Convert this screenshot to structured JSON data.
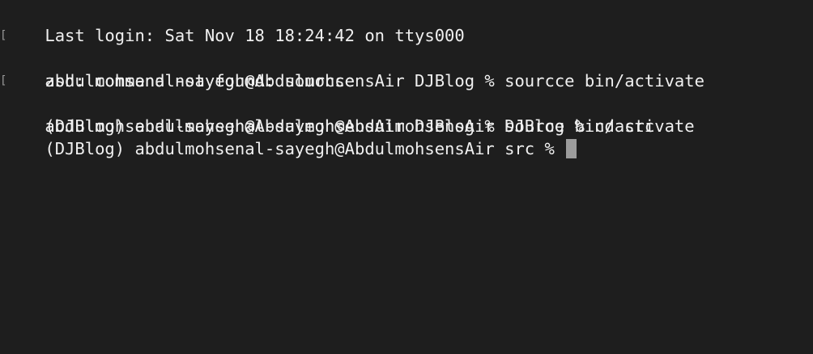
{
  "terminal": {
    "lines": [
      {
        "text": "Last login: Sat Nov 18 18:24:42 on ttys000"
      },
      {
        "text": "abdulmohsenal-sayegh@AbdulmohsensAir DJBlog % sourcce bin/activate"
      },
      {
        "text": "zsh: command not found: sourcce"
      },
      {
        "text": "abdulmohsenal-sayegh@AbdulmohsensAir DJBlog % source bin/activate"
      },
      {
        "text": "(DJBlog) abdulmohsenal-sayegh@AbdulmohsensAir DJBlog % cd src"
      },
      {
        "text": "(DJBlog) abdulmohsenal-sayegh@AbdulmohsensAir src %"
      }
    ],
    "colors": {
      "background": "#1e1e1e",
      "foreground": "#f0f0f0",
      "cursor": "#9c9c9c"
    }
  }
}
